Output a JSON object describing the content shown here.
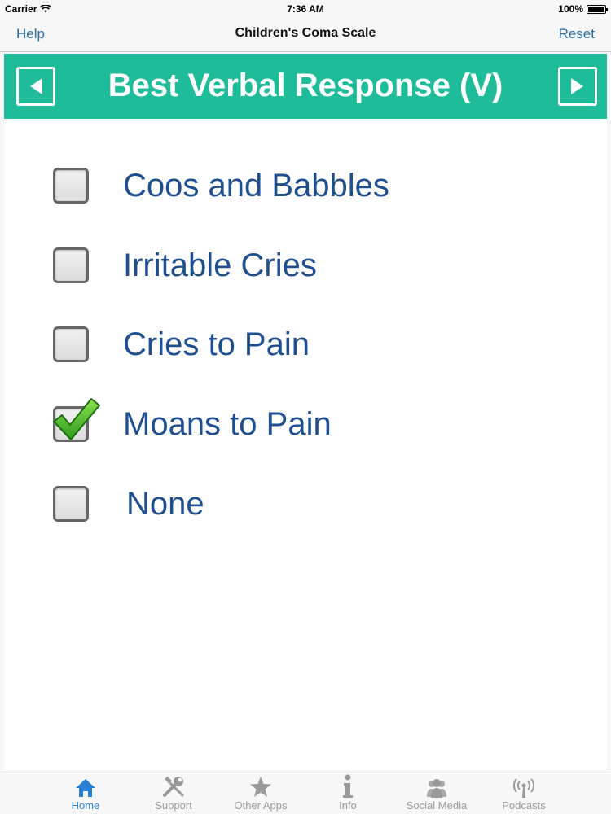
{
  "status_bar": {
    "carrier": "Carrier",
    "time": "7:36 AM",
    "battery": "100%"
  },
  "nav": {
    "left": "Help",
    "title": "Children's Coma Scale",
    "right": "Reset"
  },
  "header": {
    "title": "Best Verbal Response (V)",
    "color": "#1ebc98"
  },
  "options": [
    {
      "label": "Coos and Babbles",
      "checked": false
    },
    {
      "label": "Irritable Cries",
      "checked": false
    },
    {
      "label": "Cries to Pain",
      "checked": false
    },
    {
      "label": "Moans to Pain",
      "checked": true
    },
    {
      "label": "None",
      "checked": false
    }
  ],
  "tabs": [
    {
      "label": "Home",
      "icon": "home-icon",
      "active": true
    },
    {
      "label": "Support",
      "icon": "wrench-screwdriver-icon",
      "active": false
    },
    {
      "label": "Other Apps",
      "icon": "star-icon",
      "active": false
    },
    {
      "label": "Info",
      "icon": "info-icon",
      "active": false
    },
    {
      "label": "Social Media",
      "icon": "people-icon",
      "active": false
    },
    {
      "label": "Podcasts",
      "icon": "podcast-icon",
      "active": false
    }
  ],
  "colors": {
    "accent": "#2a7fd4",
    "label_text": "#1f4f8f",
    "check_green": "#3fae2a"
  }
}
